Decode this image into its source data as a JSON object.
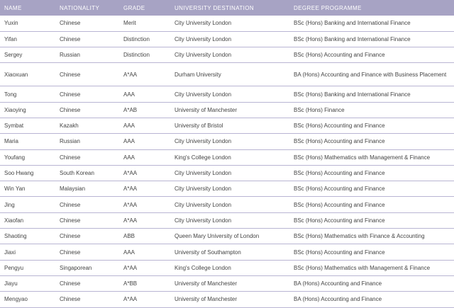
{
  "headers": [
    "NAME",
    "NATIONALITY",
    "GRADE",
    "UNIVERSITY DESTINATION",
    "DEGREE PROGRAMME"
  ],
  "rows": [
    {
      "name": "Yuxin",
      "nationality": "Chinese",
      "grade": "Merit",
      "university": "City University London",
      "degree": "BSc (Hons) Banking and International Finance"
    },
    {
      "name": "Yifan",
      "nationality": "Chinese",
      "grade": "Distinction",
      "university": "City University London",
      "degree": "BSc (Hons) Banking and International Finance"
    },
    {
      "name": "Sergey",
      "nationality": "Russian",
      "grade": "Distinction",
      "university": "City University London",
      "degree": "BSc (Hons) Accounting and Finance"
    },
    {
      "name": "Xiaoxuan",
      "nationality": "Chinese",
      "grade": "A*AA",
      "university": "Durham University",
      "degree": "BA (Hons) Accounting and Finance with Business Placement"
    },
    {
      "name": "Tong",
      "nationality": "Chinese",
      "grade": "AAA",
      "university": "City University London",
      "degree": "BSc (Hons) Banking and International Finance"
    },
    {
      "name": "Xiaoying",
      "nationality": "Chinese",
      "grade": "A*AB",
      "university": "University of Manchester",
      "degree": "BSc (Hons) Finance"
    },
    {
      "name": "Symbat",
      "nationality": "Kazakh",
      "grade": "AAA",
      "university": "University of Bristol",
      "degree": "BSc (Hons) Accounting and Finance"
    },
    {
      "name": "Maria",
      "nationality": "Russian",
      "grade": "AAA",
      "university": "City University London",
      "degree": "BSc (Hons) Accounting and Finance"
    },
    {
      "name": "Youfang",
      "nationality": "Chinese",
      "grade": "AAA",
      "university": "King's College London",
      "degree": "BSc (Hons) Mathematics with Management & Finance"
    },
    {
      "name": "Soo Hwang",
      "nationality": "South Korean",
      "grade": "A*AA",
      "university": "City University London",
      "degree": "BSc (Hons) Accounting and Finance"
    },
    {
      "name": "Win Yan",
      "nationality": "Malaysian",
      "grade": "A*AA",
      "university": "City University London",
      "degree": "BSc (Hons) Accounting and Finance"
    },
    {
      "name": "Jing",
      "nationality": "Chinese",
      "grade": "A*AA",
      "university": "City University London",
      "degree": "BSc (Hons) Accounting and Finance"
    },
    {
      "name": "Xiaofan",
      "nationality": "Chinese",
      "grade": "A*AA",
      "university": "City University London",
      "degree": "BSc (Hons) Accounting and Finance"
    },
    {
      "name": "Shaoting",
      "nationality": "Chinese",
      "grade": "ABB",
      "university": "Queen Mary University of London",
      "degree": "BSc (Hons) Mathematics with Finance & Accounting"
    },
    {
      "name": "Jiaxi",
      "nationality": "Chinese",
      "grade": "AAA",
      "university": "University of Southampton",
      "degree": "BSc (Hons) Accounting and Finance"
    },
    {
      "name": "Pengyu",
      "nationality": "Singaporean",
      "grade": "A*AA",
      "university": "King's College London",
      "degree": "BSc (Hons) Mathematics with Management & Finance"
    },
    {
      "name": "Jiayu",
      "nationality": "Chinese",
      "grade": "A*BB",
      "university": "University of Manchester",
      "degree": "BA (Hons) Accounting and Finance"
    },
    {
      "name": "Mengyao",
      "nationality": "Chinese",
      "grade": "A*AA",
      "university": "University of Manchester",
      "degree": "BA (Hons) Accounting and Finance"
    }
  ]
}
